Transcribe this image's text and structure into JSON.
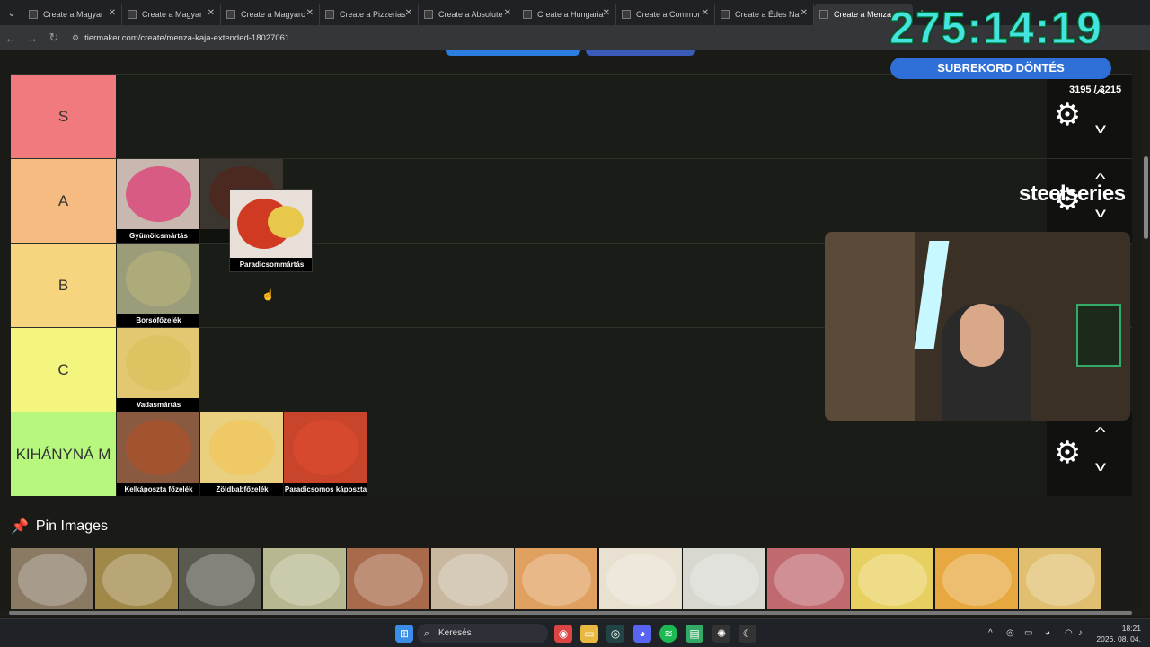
{
  "browser": {
    "tabs": [
      {
        "title": "Create a Magyar"
      },
      {
        "title": "Create a Magyar"
      },
      {
        "title": "Create a Magyarc"
      },
      {
        "title": "Create a Pizzerias"
      },
      {
        "title": "Create a Absolute"
      },
      {
        "title": "Create a Hungaria"
      },
      {
        "title": "Create a Commor"
      },
      {
        "title": "Create a Édes Na"
      },
      {
        "title": "Create a Menza"
      }
    ],
    "url": "tiermaker.com/create/menza-kaja-extended-18027061"
  },
  "tiers": [
    {
      "label": "S",
      "color": "#f07a7e",
      "items": []
    },
    {
      "label": "A",
      "color": "#f5bb80",
      "items": [
        {
          "caption": "Gyümölcsmártás",
          "bg": "#c8b8b0",
          "accent": "#d94a7a"
        },
        {
          "caption": "Para",
          "bg": "#7a6a60",
          "accent": "#b03a2a",
          "ghost": true
        }
      ]
    },
    {
      "label": "B",
      "color": "#f6d57e",
      "items": [
        {
          "caption": "Borsófőzelék",
          "bg": "#9a9c7a",
          "accent": "#b0ae7a"
        }
      ]
    },
    {
      "label": "C",
      "color": "#f4f57e",
      "items": [
        {
          "caption": "Vadasmártás",
          "bg": "#e2c870",
          "accent": "#dcc25e"
        }
      ]
    },
    {
      "label": "KIHÁNYNÁ M",
      "color": "#b8f77e",
      "items": [
        {
          "caption": "Kelkáposzta főzelék",
          "bg": "#8a5a40",
          "accent": "#a6542e"
        },
        {
          "caption": "Zöldbabfőzelék",
          "bg": "#e8d080",
          "accent": "#eec860"
        },
        {
          "caption": "Paradicsomos káposzta",
          "bg": "#c8442a",
          "accent": "#d84a30"
        }
      ]
    }
  ],
  "dragging": {
    "caption": "Paradicsommártás"
  },
  "pin": {
    "heading": "Pin Images"
  },
  "strip_colors": [
    "#8a7a64",
    "#a08848",
    "#5a5a50",
    "#b8b890",
    "#a86a4a",
    "#c8b8a0",
    "#e0a060",
    "#e8e0d0",
    "#d8d8d0",
    "#c06a70",
    "#e8d060",
    "#e8a840",
    "#e0c070"
  ],
  "overlay": {
    "timer": "275:14:19",
    "banner": "SUBREKORD DÖNTÉS",
    "count": "3195 / 3215",
    "brand": "steelseries"
  },
  "taskbar": {
    "search_placeholder": "Keresés",
    "time": "18:21",
    "date": "2026. 08. 04."
  },
  "icons": [
    "gear-icon",
    "chevron-up-icon",
    "chevron-down-icon",
    "pin-icon",
    "search-icon",
    "windows-icon"
  ]
}
